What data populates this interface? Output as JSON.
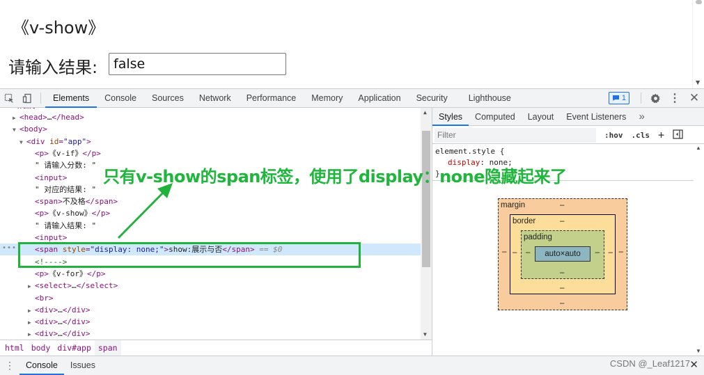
{
  "page": {
    "heading": "《v-show》",
    "result_label": "请输入结果:",
    "result_value": "false"
  },
  "devtools": {
    "tabs": [
      "Elements",
      "Console",
      "Sources",
      "Network",
      "Performance",
      "Memory",
      "Application",
      "Security",
      "Lighthouse"
    ],
    "active_tab": "Elements",
    "issues_count": "1"
  },
  "elements": {
    "lines": [
      {
        "html": "<span class='tri'>▶</span><span class='tag'>&lt;head&gt;</span><span class='txt'>…</span><span class='tag'>&lt;/head&gt;</span>"
      },
      {
        "html": "<span class='tri'>▼</span><span class='tag'>&lt;body&gt;</span>"
      },
      {
        "html": "<span class='tri'>▼</span><span class='tag'>&lt;div </span><span class='attr-name'>id</span><span class='tag'>=</span><span class='attr-val'>\"app\"</span><span class='tag'>&gt;</span>"
      },
      {
        "html": "<span class='tag'>&lt;p&gt;</span><span class='txt'>《v-if》</span><span class='tag'>&lt;/p&gt;</span>"
      },
      {
        "html": "<span class='txt'>\" 请输入分数: \"</span>"
      },
      {
        "html": "<span class='tag'>&lt;input&gt;</span>"
      },
      {
        "html": "<span class='txt'>\" 对应的结果:  \"</span>"
      },
      {
        "html": "<span class='tag'>&lt;span&gt;</span><span class='txt'>不及格</span><span class='tag'>&lt;/span&gt;</span>"
      },
      {
        "html": "<span class='tag'>&lt;p&gt;</span><span class='txt'>《v-show》</span><span class='tag'>&lt;/p&gt;</span>"
      },
      {
        "html": "<span class='txt'>\" 请输入结果: \"</span>"
      },
      {
        "html": "<span class='tag'>&lt;input&gt;</span>"
      },
      {
        "html": "<span class='tag'>&lt;span </span><span class='attr-name'>style</span><span class='tag'>=</span><span class='attr-val'>\"display: none;\"</span><span class='tag'>&gt;</span><span class='txt'>show:展示与否</span><span class='tag'>&lt;/span&gt;</span><span style='color:#888'> == </span><span style='color:#888;font-style:italic'>$0</span>"
      },
      {
        "html": "<span class='cmt'>&lt;!----&gt;</span>"
      },
      {
        "html": "<span class='tag'>&lt;p&gt;</span><span class='txt'>《v-for》</span><span class='tag'>&lt;/p&gt;</span>"
      },
      {
        "html": "<span class='tri'>▶</span><span class='tag'>&lt;select&gt;</span><span class='txt'>…</span><span class='tag'>&lt;/select&gt;</span>"
      },
      {
        "html": "<span class='tag'>&lt;br&gt;</span>"
      },
      {
        "html": "<span class='tri'>▶</span><span class='tag'>&lt;div&gt;</span><span class='txt'>…</span><span class='tag'>&lt;/div&gt;</span>"
      },
      {
        "html": "<span class='tri'>▶</span><span class='tag'>&lt;div&gt;</span><span class='txt'>…</span><span class='tag'>&lt;/div&gt;</span>"
      },
      {
        "html": "<span class='tri'>▶</span><span class='tag'>&lt;div&gt;</span><span class='txt'>…</span><span class='tag'>&lt;/div&gt;</span>"
      }
    ]
  },
  "breadcrumbs": [
    "html",
    "body",
    "div#app",
    "span"
  ],
  "styles": {
    "tabs": [
      "Styles",
      "Computed",
      "Layout",
      "Event Listeners"
    ],
    "more": "»",
    "filter_placeholder": "Filter",
    "hov": ":hov",
    "cls": ".cls",
    "selector": "element.style {",
    "property": "display",
    "value": "none;",
    "close_brace": "}"
  },
  "box_model": {
    "margin_label": "margin",
    "border_label": "border",
    "padding_label": "padding",
    "content": "auto×auto",
    "dash": "–"
  },
  "annotation": {
    "text": "只有v-show的span标签，使用了display：none隐藏起来了"
  },
  "drawer": {
    "tabs": [
      "Console",
      "Issues"
    ],
    "active_tab": "Console"
  },
  "watermark": "CSDN @_Leaf1217",
  "colors": {
    "accent": "#1a73e8",
    "annotation_green": "#1fb63c",
    "selected_row": "#cfe8fc"
  }
}
